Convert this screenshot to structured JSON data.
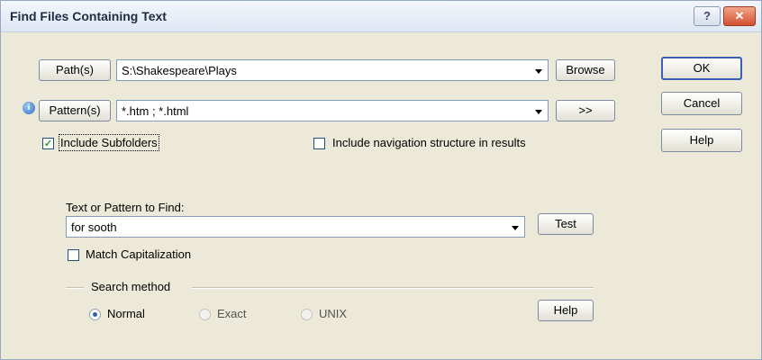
{
  "window": {
    "title": "Find Files Containing Text",
    "help_glyph": "?",
    "close_glyph": "✕"
  },
  "paths": {
    "button_label": "Path(s)",
    "value": "S:\\Shakespeare\\Plays",
    "browse_label": "Browse"
  },
  "patterns": {
    "button_label": "Pattern(s)",
    "value": "*.htm ; *.html",
    "more_label": ">>"
  },
  "options": {
    "include_subfolders": {
      "label": "Include Subfolders",
      "checked": true
    },
    "include_navigation": {
      "label": "Include navigation structure in results",
      "checked": false
    }
  },
  "find": {
    "label": "Text or Pattern to Find:",
    "value": "for sooth",
    "test_label": "Test",
    "match_capitalization": {
      "label": "Match Capitalization",
      "checked": false
    }
  },
  "search_method": {
    "label": "Search method",
    "options": [
      {
        "label": "Normal",
        "selected": true
      },
      {
        "label": "Exact",
        "selected": false
      },
      {
        "label": "UNIX",
        "selected": false
      }
    ],
    "help_label": "Help"
  },
  "actions": {
    "ok_label": "OK",
    "cancel_label": "Cancel",
    "help_label": "Help"
  },
  "icons": {
    "info": "i",
    "check": "✓"
  }
}
